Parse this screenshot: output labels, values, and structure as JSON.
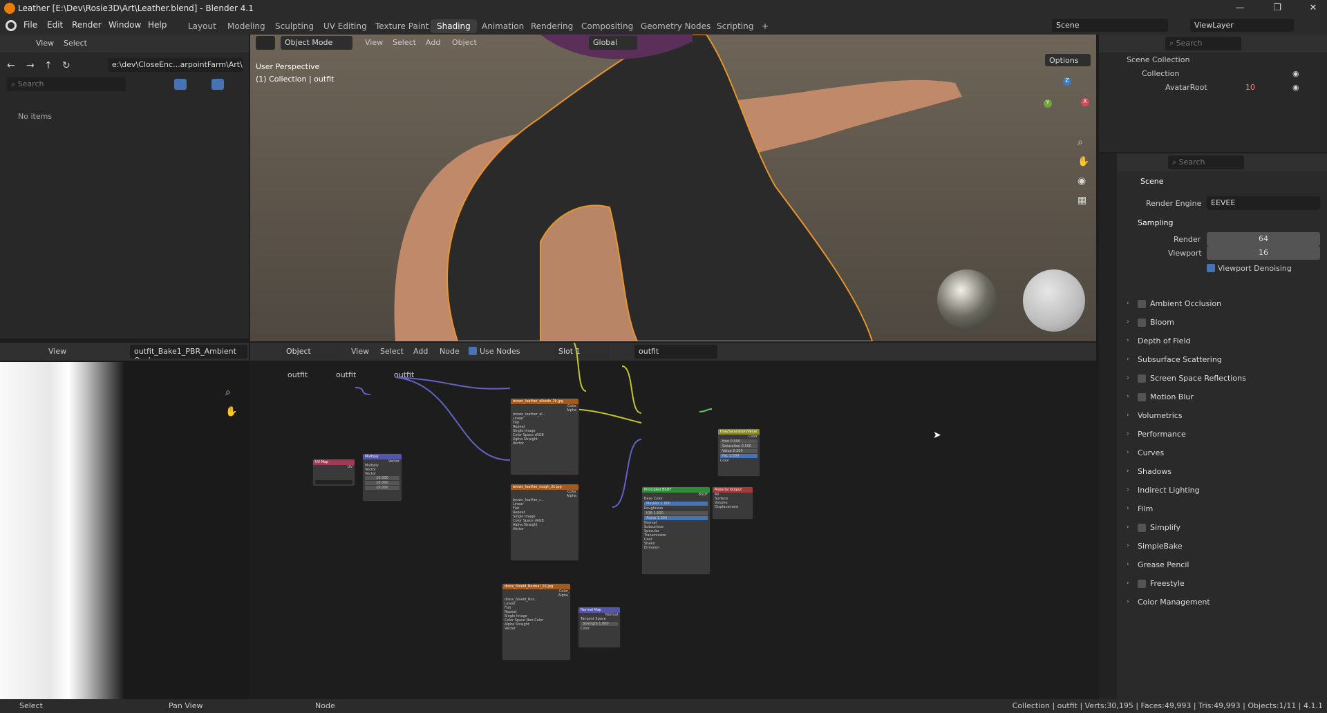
{
  "window": {
    "title": "Leather [E:\\Dev\\Rosie3D\\Art\\Leather.blend] - Blender 4.1",
    "min": "—",
    "max": "❐",
    "close": "✕"
  },
  "menu": [
    "File",
    "Edit",
    "Render",
    "Window",
    "Help"
  ],
  "workspaces": [
    "Layout",
    "Modeling",
    "Sculpting",
    "UV Editing",
    "Texture Paint",
    "Shading",
    "Animation",
    "Rendering",
    "Compositing",
    "Geometry Nodes",
    "Scripting",
    "+"
  ],
  "scene": {
    "label": "Scene",
    "viewlayer": "ViewLayer"
  },
  "filebrowser": {
    "view": "View",
    "select": "Select",
    "path": "e:\\dev\\CloseEnc...arpointFarm\\Art\\",
    "search_placeholder": "Search",
    "no_items": "No items"
  },
  "viewport": {
    "mode": "Object Mode",
    "menus": [
      "View",
      "Select",
      "Add",
      "Object"
    ],
    "orientation": "Global",
    "options": "Options",
    "persp": "User Perspective",
    "collection": "(1) Collection | outfit",
    "axes": {
      "x": "X",
      "y": "Y",
      "z": "Z"
    }
  },
  "image_editor": {
    "view": "View",
    "image_name": "outfit_Bake1_PBR_Ambient Occl"
  },
  "node_editor": {
    "type": "Object",
    "menus": [
      "View",
      "Select",
      "Add",
      "Node"
    ],
    "use_nodes": "Use Nodes",
    "slot": "Slot 1",
    "material": "outfit",
    "breadcrumb": [
      "outfit",
      "outfit",
      "outfit"
    ]
  },
  "nodes": {
    "uvmap": {
      "title": "UV Map",
      "out": "UV",
      "row": "From Instancer"
    },
    "multiply": {
      "title": "Multiply",
      "out": "Vector",
      "rows": [
        "Multiply",
        "Vector",
        "Vector",
        "10.000",
        "10.000",
        "10.000"
      ]
    },
    "albedo": {
      "title": "brown_leather_albedo_2k.jpg",
      "outs": [
        "Color",
        "Alpha"
      ],
      "rows": [
        "brown_leather_al...",
        "Linear",
        "Flat",
        "Repeat",
        "Single Image",
        "Color Space   sRGB",
        "Alpha   Straight",
        "Vector"
      ]
    },
    "rough": {
      "title": "brown_leather_rough_2k.jpg",
      "outs": [
        "Color",
        "Alpha"
      ],
      "rows": [
        "brown_leather_r...",
        "Linear",
        "Flat",
        "Repeat",
        "Single Image",
        "Color Space   sRGB",
        "Alpha   Straight",
        "Vector"
      ]
    },
    "normal_img": {
      "title": "dress_Shield_Normal_1K.jpg",
      "outs": [
        "Color",
        "Alpha"
      ],
      "rows": [
        "dress_Shield_Nor...",
        "Linear",
        "Flat",
        "Repeat",
        "Single Image",
        "Color Space   Non-Color",
        "Alpha   Straight",
        "Vector"
      ]
    },
    "hsv": {
      "title": "Hue/Saturation/Value",
      "out": "Color",
      "rows": [
        "Hue   0.500",
        "Saturation   0.500",
        "Value   0.200",
        "Fac   1.000",
        "Color"
      ]
    },
    "bsdf": {
      "title": "Principled BSDF",
      "out": "BSDF",
      "rows": [
        "Base Color",
        "Metallic   1.000",
        "Roughness",
        "IOR   1.500",
        "Alpha   1.000",
        "Normal",
        "Subsurface",
        "Specular",
        "Transmission",
        "Coat",
        "Sheen",
        "Emission"
      ]
    },
    "output": {
      "title": "Material Output",
      "rows": [
        "All",
        "Surface",
        "Volume",
        "Displacement"
      ]
    },
    "normalmap": {
      "title": "Normal Map",
      "out": "Normal",
      "rows": [
        "Tangent Space",
        "Strength   1.000",
        "Color"
      ]
    }
  },
  "outliner": {
    "search_placeholder": "Search",
    "root": "Scene Collection",
    "collection": "Collection",
    "item": "AvatarRoot",
    "item_badge": "10"
  },
  "properties": {
    "search_placeholder": "Search",
    "scene": "Scene",
    "render_engine_label": "Render Engine",
    "render_engine": "EEVEE",
    "sampling": "Sampling",
    "render_label": "Render",
    "render_val": "64",
    "viewport_label": "Viewport",
    "viewport_val": "16",
    "denoise": "Viewport Denoising",
    "panels": [
      {
        "label": "Ambient Occlusion",
        "cb": true
      },
      {
        "label": "Bloom",
        "cb": true
      },
      {
        "label": "Depth of Field",
        "cb": false
      },
      {
        "label": "Subsurface Scattering",
        "cb": false
      },
      {
        "label": "Screen Space Reflections",
        "cb": true
      },
      {
        "label": "Motion Blur",
        "cb": true
      },
      {
        "label": "Volumetrics",
        "cb": false
      },
      {
        "label": "Performance",
        "cb": false
      },
      {
        "label": "Curves",
        "cb": false
      },
      {
        "label": "Shadows",
        "cb": false
      },
      {
        "label": "Indirect Lighting",
        "cb": false
      },
      {
        "label": "Film",
        "cb": false
      },
      {
        "label": "Simplify",
        "cb": true
      },
      {
        "label": "SimpleBake",
        "cb": false
      },
      {
        "label": "Grease Pencil",
        "cb": false
      },
      {
        "label": "Freestyle",
        "cb": true
      },
      {
        "label": "Color Management",
        "cb": false
      }
    ]
  },
  "status": {
    "select": "Select",
    "pan": "Pan View",
    "node": "Node",
    "info": "Collection | outfit | Verts:30,195 | Faces:49,993 | Tris:49,993 | Objects:1/11 | 4.1.1"
  },
  "colors": {
    "accent": "#4772b3",
    "selection": "#e8952a",
    "bg": "#1d1d1d"
  }
}
